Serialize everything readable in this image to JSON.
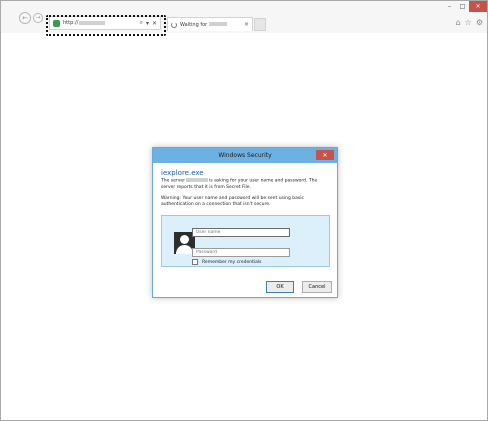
{
  "browser": {
    "address_url": "http://",
    "tab_label": "Waiting for",
    "tab_close": "×",
    "back_glyph": "←",
    "forward_glyph": "→",
    "search_glyph": "⌕",
    "dropdown_glyph": "▾",
    "stop_glyph": "✕",
    "window_controls": {
      "minimize": "–",
      "maximize": "□",
      "close": "✕"
    },
    "toolbar_icons": {
      "home": "⌂",
      "favorites": "☆",
      "settings": "⚙"
    }
  },
  "dialog": {
    "title": "Windows Security",
    "close_glyph": "✕",
    "app_name": "iexplore.exe",
    "message_prefix": "The server",
    "message_suffix": "is asking for your user name and password. The server reports that it is from Secret File.",
    "warning": "Warning: Your user name and password will be sent using basic authentication on a connection that isn't secure.",
    "username_placeholder": "User name",
    "password_placeholder": "Password",
    "remember_label": "Remember my credentials",
    "ok_label": "OK",
    "cancel_label": "Cancel"
  },
  "colors": {
    "dialog_title_bg": "#6cb1e2",
    "close_button": "#c7524a",
    "credential_panel": "#dcf0fb",
    "app_name_text": "#1f5c99"
  }
}
